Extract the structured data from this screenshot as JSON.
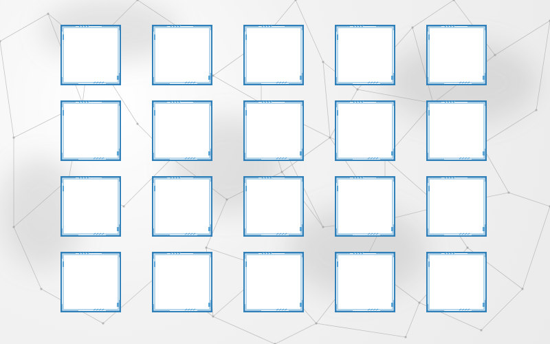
{
  "palette": {
    "frame_outer": "#2f7fb8",
    "frame_inner": "#9ec9e6",
    "frame_accent": "#5aa5d6",
    "panel": "#ffffff",
    "network_line": "#9a9a9a"
  },
  "grid": {
    "rows": 4,
    "columns": 5,
    "slot_icon": "tech-frame-slot"
  }
}
